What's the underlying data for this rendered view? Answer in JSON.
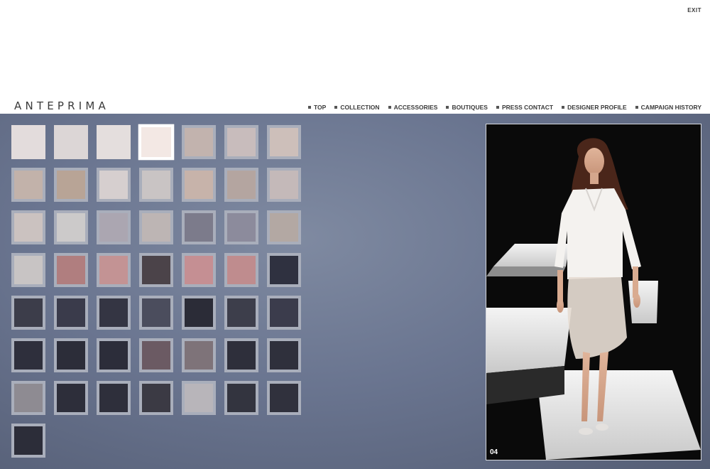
{
  "header": {
    "exit_label": "EXIT",
    "logo": "ANTEPRIMA",
    "nav": [
      "TOP",
      "COLLECTION",
      "ACCESSORIES",
      "BOUTIQUES",
      "PRESS CONTACT",
      "DESIGNER PROFILE",
      "CAMPAIGN HISTORY"
    ]
  },
  "gallery": {
    "selected_index": 4,
    "photo_number": "04",
    "thumbs": [
      {
        "color": "#e3dcdc"
      },
      {
        "color": "#dcd6d6"
      },
      {
        "color": "#e4dedd"
      },
      {
        "color": "#f3e8e4"
      },
      {
        "color": "#c2b3ae"
      },
      {
        "color": "#c8bcbc"
      },
      {
        "color": "#cdbfba"
      },
      {
        "color": "#c2b2aa"
      },
      {
        "color": "#b8a496"
      },
      {
        "color": "#d6cfcf"
      },
      {
        "color": "#c9c4c4"
      },
      {
        "color": "#c7b3aa"
      },
      {
        "color": "#b4a5a0"
      },
      {
        "color": "#c4b9b9"
      },
      {
        "color": "#cbc2c0"
      },
      {
        "color": "#cccaca"
      },
      {
        "color": "#aba6b1"
      },
      {
        "color": "#bdb5b4"
      },
      {
        "color": "#7c7b8b"
      },
      {
        "color": "#8c8b9c"
      },
      {
        "color": "#b3a8a3"
      },
      {
        "color": "#c8c4c4"
      },
      {
        "color": "#b07e7f"
      },
      {
        "color": "#c39394"
      },
      {
        "color": "#4b4349"
      },
      {
        "color": "#c58f93"
      },
      {
        "color": "#bf8c8e"
      },
      {
        "color": "#2f3140"
      },
      {
        "color": "#3c3d4a"
      },
      {
        "color": "#3a3b4b"
      },
      {
        "color": "#343543"
      },
      {
        "color": "#4b4d5d"
      },
      {
        "color": "#2b2c37"
      },
      {
        "color": "#3d3e4b"
      },
      {
        "color": "#3b3c4c"
      },
      {
        "color": "#2e2f3c"
      },
      {
        "color": "#2c2d39"
      },
      {
        "color": "#2c2d3a"
      },
      {
        "color": "#6b5a63"
      },
      {
        "color": "#7e7379"
      },
      {
        "color": "#2e2f3b"
      },
      {
        "color": "#2f303c"
      },
      {
        "color": "#8e8b92"
      },
      {
        "color": "#2d2e3a"
      },
      {
        "color": "#2e2f3b"
      },
      {
        "color": "#3b3a44"
      },
      {
        "color": "#b8b5ba"
      },
      {
        "color": "#33343f"
      },
      {
        "color": "#30313d"
      },
      {
        "color": "#2c2d39"
      }
    ]
  }
}
